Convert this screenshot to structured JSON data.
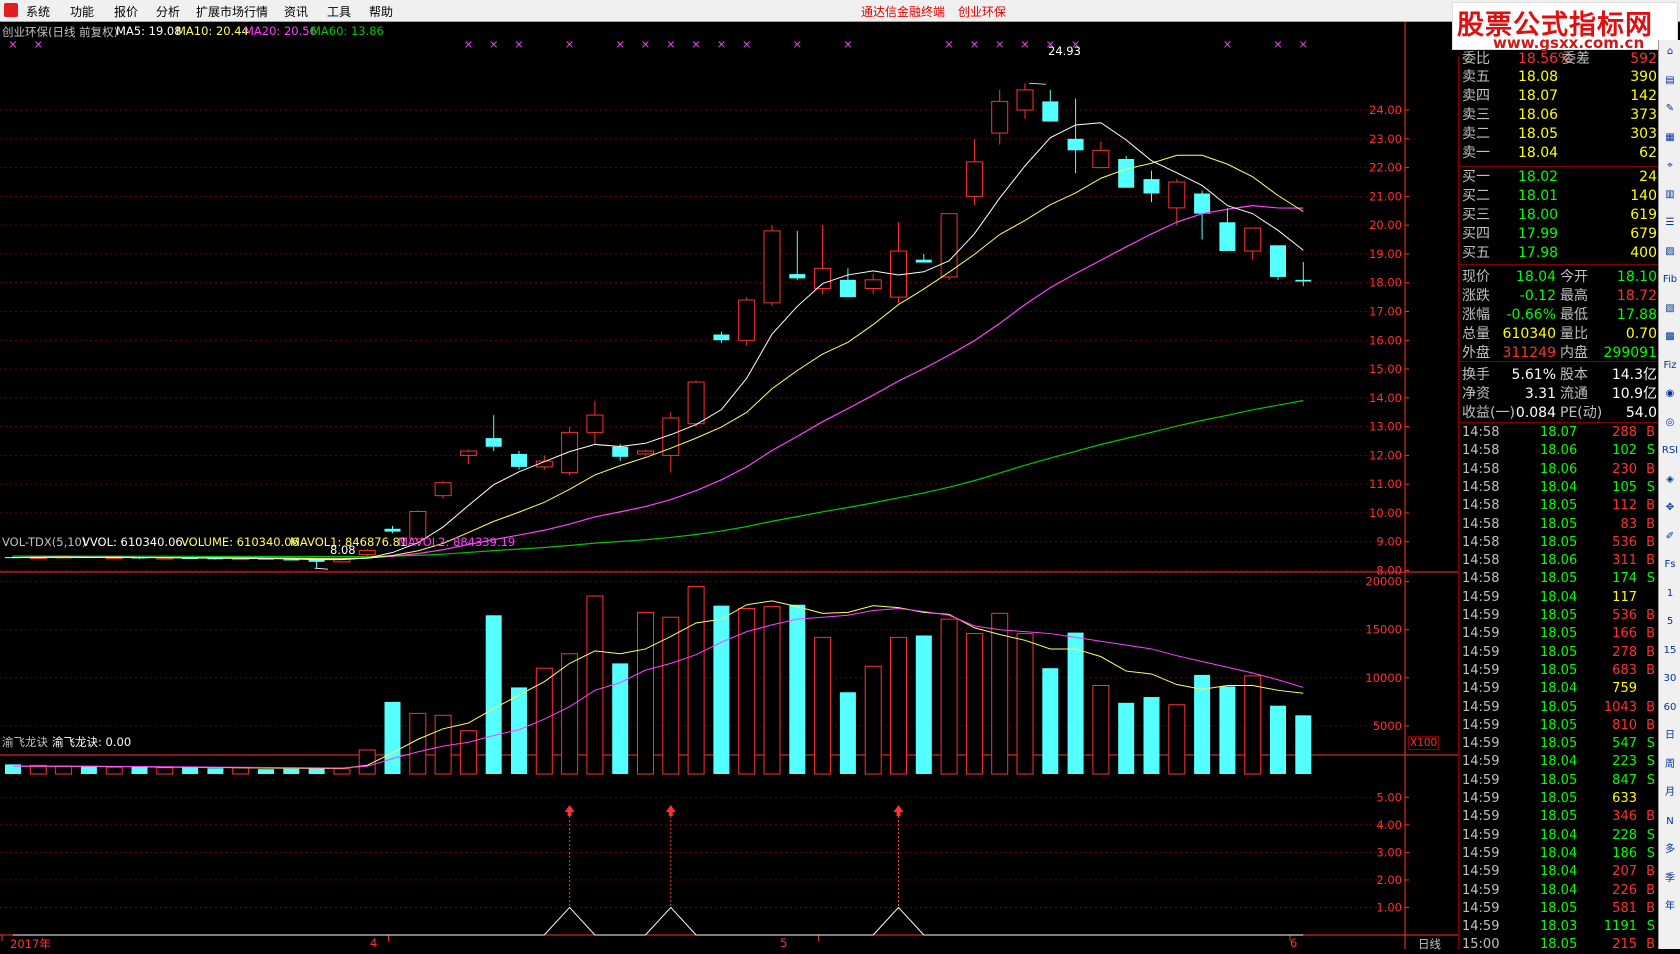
{
  "menu": [
    "系统",
    "功能",
    "报价",
    "分析",
    "扩展市场行情",
    "资讯",
    "工具",
    "帮助"
  ],
  "brand": {
    "terminal": "通达信金融终端",
    "stock": "创业环保"
  },
  "watermark": {
    "title": "股票公式指标网",
    "url": "www.gsxx.com.cn"
  },
  "price_header": {
    "title": "创业环保(日线 前复权)",
    "ma5": "MA5: 19.08",
    "ma10": "MA10: 20.44",
    "ma20": "MA20: 20.56",
    "ma60": "MA60: 13.86"
  },
  "volume_header": {
    "title": "VOL-TDX(5,10)",
    "vvol": "VVOL: 610340.06",
    "volume": "VOLUME: 610340.06",
    "mavol1": "MAVOL1: 846876.81",
    "mavol2": "MAVOL2: 884339.19"
  },
  "indicator_header": {
    "name": "渝飞龙诀",
    "value": "渝飞龙诀: 0.00"
  },
  "annotations": {
    "high": "24.93",
    "low": "8.08",
    "vol_unit": "X100"
  },
  "x_labels": [
    "2017年",
    "4",
    "5",
    "6"
  ],
  "period": "日线",
  "colors": {
    "up": "#ff3030",
    "down": "#54ffff",
    "ma5": "#ffffff",
    "ma10": "#ffff60",
    "ma20": "#ff40ff",
    "ma60": "#00c800",
    "grid": "#800000",
    "axis": "#ff3030"
  },
  "chart_data": [
    {
      "type": "candlestick",
      "y_ticks": [
        "8.00",
        "9.00",
        "10.00",
        "11.00",
        "12.00",
        "13.00",
        "14.00",
        "15.00",
        "16.00",
        "17.00",
        "18.00",
        "19.00",
        "20.00",
        "21.00",
        "22.00",
        "23.00",
        "24.00"
      ],
      "ylim": [
        7.6,
        25.6
      ],
      "candles": [
        [
          8.47,
          8.5,
          8.42,
          8.45
        ],
        [
          8.45,
          8.48,
          8.42,
          8.46
        ],
        [
          8.46,
          8.5,
          8.44,
          8.48
        ],
        [
          8.48,
          8.5,
          8.43,
          8.44
        ],
        [
          8.44,
          8.47,
          8.42,
          8.46
        ],
        [
          8.46,
          8.49,
          8.4,
          8.42
        ],
        [
          8.42,
          8.46,
          8.4,
          8.44
        ],
        [
          8.44,
          8.47,
          8.41,
          8.43
        ],
        [
          8.43,
          8.46,
          8.38,
          8.4
        ],
        [
          8.4,
          8.44,
          8.37,
          8.42
        ],
        [
          8.42,
          8.45,
          8.38,
          8.39
        ],
        [
          8.39,
          8.42,
          8.35,
          8.37
        ],
        [
          8.37,
          8.42,
          8.08,
          8.3
        ],
        [
          8.3,
          8.42,
          8.28,
          8.4
        ],
        [
          8.55,
          8.75,
          8.5,
          8.7
        ],
        [
          9.45,
          9.55,
          9.3,
          9.35
        ],
        [
          9.1,
          10.1,
          9.05,
          10.05
        ],
        [
          10.6,
          11.1,
          10.5,
          11.05
        ],
        [
          12.0,
          12.2,
          11.7,
          12.15
        ],
        [
          12.6,
          13.4,
          12.15,
          12.3
        ],
        [
          12.05,
          12.15,
          11.5,
          11.6
        ],
        [
          11.6,
          12.0,
          11.5,
          11.8
        ],
        [
          11.4,
          13.0,
          11.3,
          12.8
        ],
        [
          12.8,
          13.9,
          12.4,
          13.4
        ],
        [
          12.3,
          12.4,
          11.8,
          11.95
        ],
        [
          12.05,
          12.2,
          12.0,
          12.15
        ],
        [
          12.0,
          13.5,
          11.4,
          13.3
        ],
        [
          13.1,
          14.6,
          13.0,
          14.55
        ],
        [
          16.2,
          16.3,
          15.9,
          16.0
        ],
        [
          16.0,
          17.5,
          15.8,
          17.4
        ],
        [
          17.3,
          20.0,
          17.2,
          19.8
        ],
        [
          18.3,
          19.8,
          18.1,
          18.15
        ],
        [
          17.8,
          20.0,
          17.6,
          18.5
        ],
        [
          18.1,
          18.5,
          17.6,
          17.5
        ],
        [
          17.8,
          18.3,
          17.6,
          18.1
        ],
        [
          17.5,
          20.1,
          17.3,
          19.1
        ],
        [
          18.8,
          19.0,
          18.7,
          18.7
        ],
        [
          18.2,
          20.2,
          18.1,
          20.4
        ],
        [
          21.0,
          23.0,
          20.7,
          22.2
        ],
        [
          23.2,
          24.7,
          22.8,
          24.3
        ],
        [
          24.0,
          24.93,
          23.7,
          24.7
        ],
        [
          24.3,
          24.7,
          23.6,
          23.6
        ],
        [
          23.0,
          24.4,
          21.8,
          22.6
        ],
        [
          22.0,
          22.9,
          22.1,
          22.6
        ],
        [
          22.3,
          22.4,
          21.3,
          21.3
        ],
        [
          21.6,
          21.9,
          20.8,
          21.1
        ],
        [
          20.6,
          21.6,
          20.0,
          21.5
        ],
        [
          21.1,
          21.2,
          19.5,
          20.4
        ],
        [
          20.1,
          20.6,
          19.1,
          19.1
        ],
        [
          19.1,
          19.9,
          18.8,
          19.9
        ],
        [
          19.3,
          19.3,
          18.1,
          18.2
        ],
        [
          18.1,
          18.72,
          17.88,
          18.04
        ]
      ]
    },
    {
      "type": "bar",
      "name": "VOLUME",
      "y_ticks": [
        "5000",
        "10000",
        "15000",
        "20000"
      ],
      "ylim": [
        0,
        21000
      ],
      "values": [
        1000,
        900,
        800,
        850,
        700,
        750,
        650,
        700,
        600,
        650,
        500,
        550,
        600,
        550,
        2500,
        7500,
        6300,
        6100,
        4500,
        16500,
        9000,
        11000,
        12500,
        18500,
        11500,
        16800,
        16300,
        19500,
        17500,
        17200,
        17400,
        17600,
        14200,
        8500,
        11200,
        14200,
        14400,
        16100,
        14600,
        16700,
        14600,
        11000,
        14700,
        9200,
        7400,
        8000,
        7200,
        10300,
        9100,
        10200,
        7100,
        6100
      ],
      "mavol1": [
        800,
        810,
        800,
        790,
        780,
        760,
        720,
        700,
        680,
        650,
        630,
        610,
        590,
        580,
        900,
        2200,
        3600,
        4700,
        5300,
        6800,
        8200,
        9600,
        11500,
        12800,
        12500,
        13000,
        14300,
        15700,
        16100,
        17600,
        18000,
        17400,
        16700,
        16800,
        17500,
        17300,
        16800,
        16600,
        15200,
        14500,
        13900,
        13000,
        13000,
        12200,
        10700,
        10400,
        9300,
        8800,
        9200,
        9200,
        8700,
        8400
      ],
      "mavol2": [
        800,
        800,
        800,
        800,
        790,
        780,
        760,
        740,
        720,
        700,
        680,
        660,
        640,
        620,
        800,
        1600,
        2300,
        2900,
        3300,
        4000,
        4600,
        5700,
        7000,
        8700,
        9500,
        10800,
        11500,
        12400,
        13700,
        14800,
        15500,
        16100,
        16300,
        16500,
        17000,
        17200,
        16900,
        16500,
        15400,
        15000,
        14800,
        14600,
        14200,
        13800,
        13400,
        13000,
        12300,
        11700,
        11100,
        10500,
        9800,
        9000
      ]
    },
    {
      "type": "line",
      "name": "渝飞龙诀",
      "y_ticks": [
        "1.00",
        "2.00",
        "3.00",
        "4.00",
        "5.00"
      ],
      "ylim": [
        0,
        5.7
      ],
      "x": [
        0,
        21,
        22,
        23,
        25,
        26,
        27,
        34,
        35,
        36,
        51
      ],
      "values": [
        0,
        0,
        1,
        0,
        0,
        1,
        0,
        0,
        1,
        0,
        0
      ],
      "signals": [
        22,
        26,
        35
      ]
    }
  ],
  "quote": {
    "weibi": {
      "label": "委比",
      "value": "18.56%",
      "label2": "委差",
      "value2": "592"
    },
    "sell": [
      {
        "label": "卖五",
        "price": "18.08",
        "vol": "390"
      },
      {
        "label": "卖四",
        "price": "18.07",
        "vol": "142"
      },
      {
        "label": "卖三",
        "price": "18.06",
        "vol": "373"
      },
      {
        "label": "卖二",
        "price": "18.05",
        "vol": "303"
      },
      {
        "label": "卖一",
        "price": "18.04",
        "vol": "62"
      }
    ],
    "buy": [
      {
        "label": "买一",
        "price": "18.02",
        "vol": "24"
      },
      {
        "label": "买二",
        "price": "18.01",
        "vol": "140"
      },
      {
        "label": "买三",
        "price": "18.00",
        "vol": "619"
      },
      {
        "label": "买四",
        "price": "17.99",
        "vol": "679"
      },
      {
        "label": "买五",
        "price": "17.98",
        "vol": "400"
      }
    ],
    "stats": [
      [
        {
          "l": "现价",
          "v": "18.04",
          "c": "#00ff00"
        },
        {
          "l": "今开",
          "v": "18.10",
          "c": "#00ff00"
        }
      ],
      [
        {
          "l": "涨跌",
          "v": "-0.12",
          "c": "#00ff00"
        },
        {
          "l": "最高",
          "v": "18.72",
          "c": "#ff3030"
        }
      ],
      [
        {
          "l": "涨幅",
          "v": "-0.66%",
          "c": "#00ff00"
        },
        {
          "l": "最低",
          "v": "17.88",
          "c": "#00ff00"
        }
      ],
      [
        {
          "l": "总量",
          "v": "610340",
          "c": "#ffff00"
        },
        {
          "l": "量比",
          "v": "0.70",
          "c": "#ffff00"
        }
      ],
      [
        {
          "l": "外盘",
          "v": "311249",
          "c": "#ff3030"
        },
        {
          "l": "内盘",
          "v": "299091",
          "c": "#00ff00"
        }
      ]
    ],
    "stats2": [
      [
        {
          "l": "换手",
          "v": "5.61%"
        },
        {
          "l": "股本",
          "v": "14.3亿"
        }
      ],
      [
        {
          "l": "净资",
          "v": "3.31"
        },
        {
          "l": "流通",
          "v": "10.9亿"
        }
      ],
      [
        {
          "l": "收益(一)",
          "v": "0.084"
        },
        {
          "l": "PE(动)",
          "v": "54.0"
        }
      ]
    ],
    "ticks": [
      [
        "14:58",
        "18.07",
        "288",
        "B"
      ],
      [
        "14:58",
        "18.06",
        "102",
        "S"
      ],
      [
        "14:58",
        "18.06",
        "230",
        "B"
      ],
      [
        "14:58",
        "18.04",
        "105",
        "S"
      ],
      [
        "14:58",
        "18.05",
        "112",
        "B"
      ],
      [
        "14:58",
        "18.05",
        "83",
        "B"
      ],
      [
        "14:58",
        "18.05",
        "536",
        "B"
      ],
      [
        "14:58",
        "18.06",
        "311",
        "B"
      ],
      [
        "14:58",
        "18.05",
        "174",
        "S"
      ],
      [
        "14:59",
        "18.04",
        "117",
        ""
      ],
      [
        "14:59",
        "18.05",
        "536",
        "B"
      ],
      [
        "14:59",
        "18.05",
        "166",
        "B"
      ],
      [
        "14:59",
        "18.05",
        "278",
        "B"
      ],
      [
        "14:59",
        "18.05",
        "683",
        "B"
      ],
      [
        "14:59",
        "18.04",
        "759",
        ""
      ],
      [
        "14:59",
        "18.05",
        "1043",
        "B"
      ],
      [
        "14:59",
        "18.05",
        "810",
        "B"
      ],
      [
        "14:59",
        "18.05",
        "547",
        "S"
      ],
      [
        "14:59",
        "18.04",
        "223",
        "S"
      ],
      [
        "14:59",
        "18.05",
        "847",
        "S"
      ],
      [
        "14:59",
        "18.05",
        "633",
        ""
      ],
      [
        "14:59",
        "18.05",
        "346",
        "B"
      ],
      [
        "14:59",
        "18.04",
        "228",
        "S"
      ],
      [
        "14:59",
        "18.04",
        "186",
        "S"
      ],
      [
        "14:59",
        "18.04",
        "207",
        "B"
      ],
      [
        "14:59",
        "18.04",
        "226",
        "B"
      ],
      [
        "14:59",
        "18.05",
        "581",
        "B"
      ],
      [
        "14:59",
        "18.03",
        "1191",
        "S"
      ],
      [
        "15:00",
        "18.05",
        "215",
        "B"
      ]
    ]
  },
  "right_toolbar": [
    "⌂",
    "▤",
    "✎",
    "▦",
    "⌖",
    "▥",
    "☰",
    "▨",
    "Fib",
    "▧",
    "▩",
    "Fiz",
    "◉",
    "◎",
    "RSI",
    "◈",
    "✥",
    "✐",
    "Fs",
    "1",
    "5",
    "15",
    "30",
    "60",
    "日",
    "周",
    "月",
    "N",
    "多",
    "季",
    "年"
  ]
}
